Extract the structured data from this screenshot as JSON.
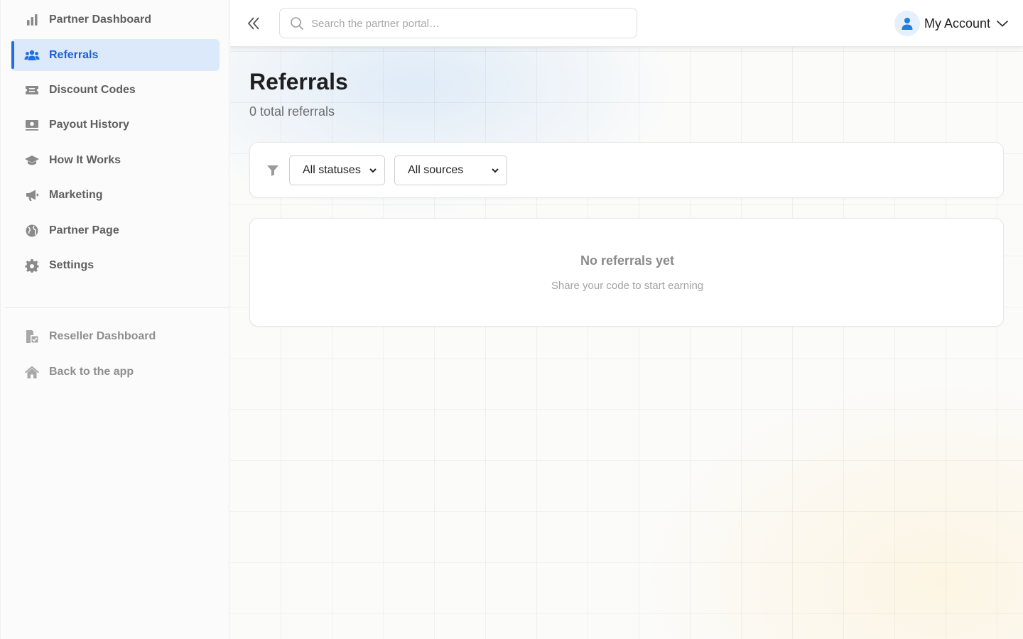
{
  "sidebar": {
    "primary_items": [
      {
        "label": "Partner Dashboard",
        "icon": "bar-chart-icon"
      },
      {
        "label": "Referrals",
        "icon": "users-icon",
        "active": true
      },
      {
        "label": "Discount Codes",
        "icon": "ticket-icon"
      },
      {
        "label": "Payout History",
        "icon": "money-bill-icon"
      },
      {
        "label": "How It Works",
        "icon": "graduation-cap-icon"
      },
      {
        "label": "Marketing",
        "icon": "megaphone-icon"
      },
      {
        "label": "Partner Page",
        "icon": "globe-icon"
      },
      {
        "label": "Settings",
        "icon": "gear-icon"
      }
    ],
    "secondary_items": [
      {
        "label": "Reseller Dashboard",
        "icon": "reseller-icon"
      },
      {
        "label": "Back to the app",
        "icon": "home-icon"
      }
    ]
  },
  "topbar": {
    "search_placeholder": "Search the partner portal…",
    "account_label": "My Account"
  },
  "page": {
    "title": "Referrals",
    "subtitle": "0 total referrals"
  },
  "filters": {
    "status_selected": "All statuses",
    "source_selected": "All sources"
  },
  "empty_state": {
    "title": "No referrals yet",
    "message": "Share your code to start earning"
  },
  "colors": {
    "accent": "#1f6fe0",
    "active_bg": "#dbe9fb"
  }
}
